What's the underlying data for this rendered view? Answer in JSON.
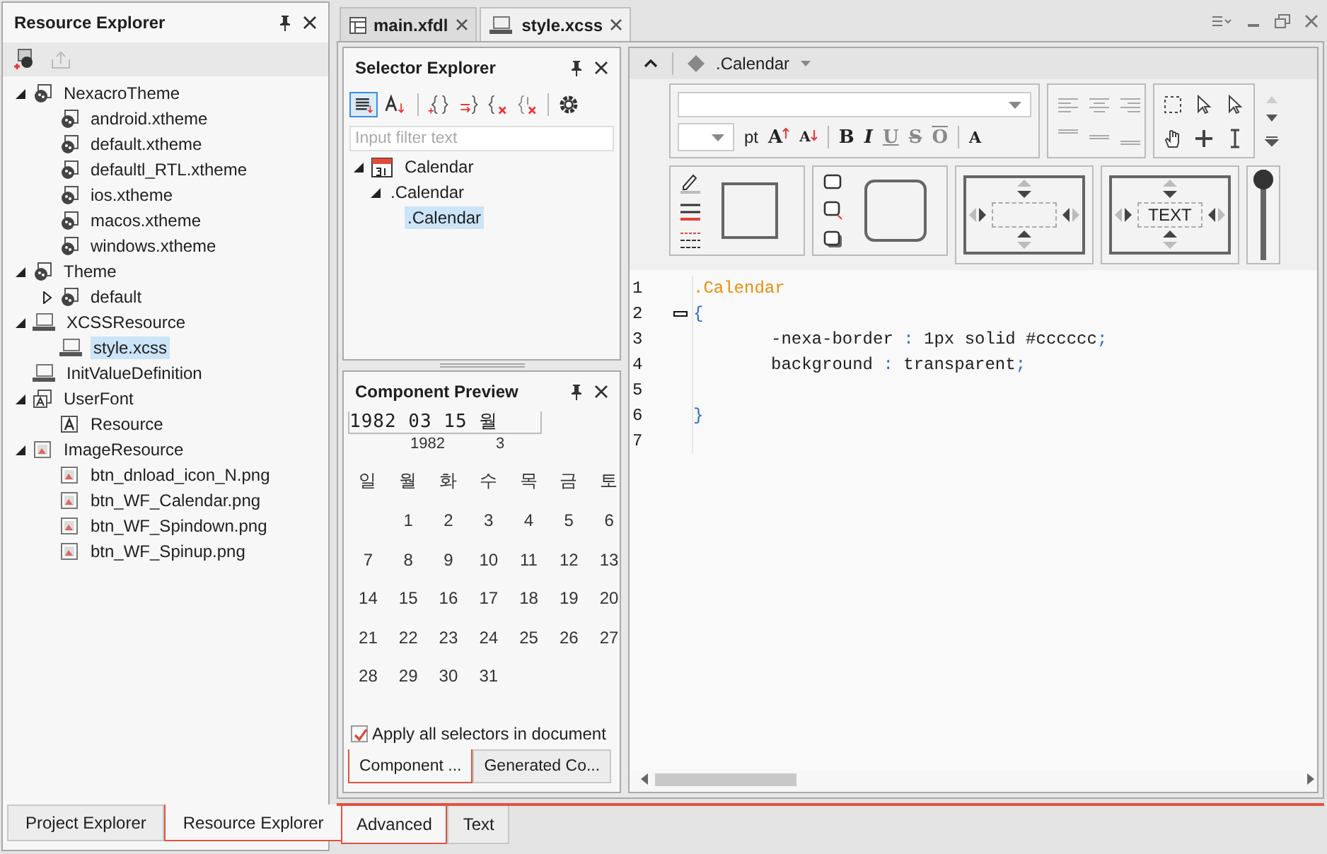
{
  "resource_explorer": {
    "title": "Resource Explorer",
    "tree": [
      {
        "label": "NexacroTheme",
        "kind": "theme",
        "expanded": true,
        "selected": false,
        "children": [
          {
            "label": "android.xtheme",
            "kind": "theme",
            "selected": false
          },
          {
            "label": "default.xtheme",
            "kind": "theme",
            "selected": false
          },
          {
            "label": "defaultl_RTL.xtheme",
            "kind": "theme",
            "selected": false
          },
          {
            "label": "ios.xtheme",
            "kind": "theme",
            "selected": false
          },
          {
            "label": "macos.xtheme",
            "kind": "theme",
            "selected": false
          },
          {
            "label": "windows.xtheme",
            "kind": "theme",
            "selected": false
          }
        ]
      },
      {
        "label": "Theme",
        "kind": "theme",
        "expanded": true,
        "selected": false,
        "children": [
          {
            "label": "default",
            "kind": "theme",
            "expanded": false,
            "selected": false
          }
        ]
      },
      {
        "label": "XCSSResource",
        "kind": "xcss",
        "expanded": true,
        "selected": false,
        "children": [
          {
            "label": "style.xcss",
            "kind": "xcss",
            "selected": true
          }
        ]
      },
      {
        "label": "InitValueDefinition",
        "kind": "init",
        "selected": false
      },
      {
        "label": "UserFont",
        "kind": "font",
        "expanded": true,
        "selected": false,
        "children": [
          {
            "label": "Resource",
            "kind": "fontfile",
            "selected": false
          }
        ]
      },
      {
        "label": "ImageResource",
        "kind": "image",
        "expanded": true,
        "selected": false,
        "children": [
          {
            "label": "btn_dnload_icon_N.png",
            "kind": "image",
            "selected": false
          },
          {
            "label": "btn_WF_Calendar.png",
            "kind": "image",
            "selected": false
          },
          {
            "label": "btn_WF_Spindown.png",
            "kind": "image",
            "selected": false
          },
          {
            "label": "btn_WF_Spinup.png",
            "kind": "image",
            "selected": false
          }
        ]
      }
    ]
  },
  "left_tabs": [
    {
      "label": "Project Explorer",
      "selected": false
    },
    {
      "label": "Resource Explorer",
      "selected": true
    }
  ],
  "document_tabs": [
    {
      "label": "main.xfdl",
      "kind": "form",
      "selected": false
    },
    {
      "label": "style.xcss",
      "kind": "xcss",
      "selected": true
    }
  ],
  "selector_explorer": {
    "title": "Selector Explorer",
    "filter": {
      "placeholder": "Input filter text"
    },
    "tree": [
      {
        "label": "Calendar",
        "kind": "calendar",
        "expanded": true,
        "selected": false,
        "children": [
          {
            "label": ".Calendar",
            "expanded": true,
            "selected": false,
            "children": [
              {
                "label": ".Calendar",
                "selected": true
              }
            ]
          }
        ]
      }
    ]
  },
  "component_preview": {
    "title": "Component Preview",
    "calendar": {
      "value": "1982 03 15 월",
      "year": "1982",
      "month": "3",
      "weekdays": [
        "일",
        "월",
        "화",
        "수",
        "목",
        "금",
        "토"
      ],
      "weeks": [
        [
          "1",
          "2",
          "3",
          "4",
          "5",
          "6"
        ],
        [
          "7",
          "8",
          "9",
          "10",
          "11",
          "12",
          "13"
        ],
        [
          "14",
          "15",
          "16",
          "17",
          "18",
          "19",
          "20"
        ],
        [
          "21",
          "22",
          "23",
          "24",
          "25",
          "26",
          "27"
        ],
        [
          "28",
          "29",
          "30",
          "31"
        ]
      ]
    },
    "apply_all": {
      "label": "Apply all selectors in document",
      "checked": true
    },
    "tabs": [
      {
        "label": "Component ...",
        "selected": true
      },
      {
        "label": "Generated Co...",
        "selected": false
      }
    ]
  },
  "editor": {
    "selector": ".Calendar",
    "font_buttons": [
      {
        "label": "pt",
        "kind": "unit",
        "disabled": false
      },
      {
        "label": "A",
        "kind": "grow",
        "disabled": false
      },
      {
        "label": "A",
        "kind": "shrink",
        "disabled": false
      },
      {
        "label": "B",
        "kind": "bold",
        "disabled": false
      },
      {
        "label": "I",
        "kind": "italic",
        "disabled": false
      },
      {
        "label": "U",
        "kind": "underline",
        "disabled": true
      },
      {
        "label": "S",
        "kind": "strike",
        "disabled": true
      },
      {
        "label": "O",
        "kind": "overline",
        "disabled": true
      },
      {
        "label": "A",
        "kind": "color",
        "disabled": false
      }
    ],
    "padding_preview_text": "TEXT",
    "opacity": {
      "level": 1
    },
    "code_lines": [
      {
        "number": "1",
        "indented": false,
        "foldable": false,
        "tokens": [
          {
            "text": ".Calendar",
            "kind": "selector"
          }
        ]
      },
      {
        "number": "2",
        "indented": false,
        "foldable": true,
        "tokens": [
          {
            "text": "{",
            "kind": "punct"
          }
        ]
      },
      {
        "number": "3",
        "indented": true,
        "foldable": false,
        "tokens": [
          {
            "text": "-nexa-border",
            "kind": "property"
          },
          {
            "text": " : ",
            "kind": "punct"
          },
          {
            "text": "1px solid #cccccc",
            "kind": "value"
          },
          {
            "text": ";",
            "kind": "punct"
          }
        ]
      },
      {
        "number": "4",
        "indented": true,
        "foldable": false,
        "tokens": [
          {
            "text": "background",
            "kind": "property"
          },
          {
            "text": " : ",
            "kind": "punct"
          },
          {
            "text": "transparent",
            "kind": "value"
          },
          {
            "text": ";",
            "kind": "punct"
          }
        ]
      },
      {
        "number": "5",
        "foldable": false
      },
      {
        "number": "6",
        "indented": false,
        "foldable": false,
        "tokens": [
          {
            "text": "}",
            "kind": "punct"
          }
        ]
      },
      {
        "number": "7",
        "foldable": false
      }
    ],
    "tabs": [
      {
        "label": "Advanced",
        "selected": true
      },
      {
        "label": "Text",
        "selected": false
      }
    ]
  }
}
